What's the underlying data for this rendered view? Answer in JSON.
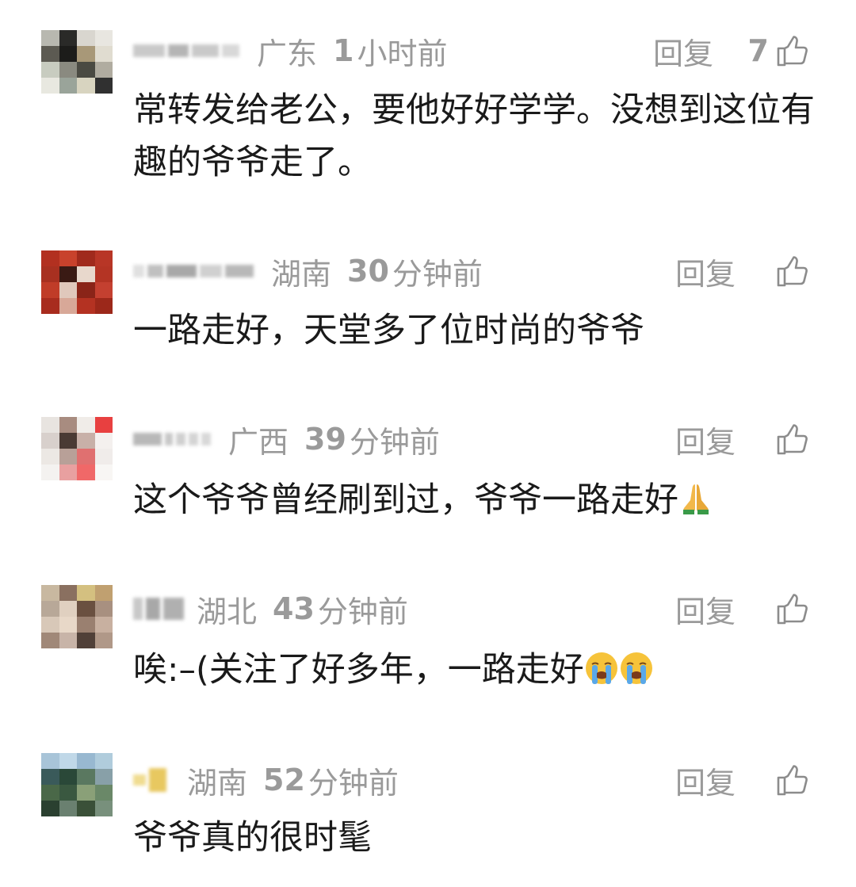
{
  "reply_label": "回复",
  "comments": [
    {
      "region": "广东",
      "time_num": "1",
      "time_unit": "小时前",
      "likes": "7",
      "text": "常转发给老公，要他好好学学。没想到这位有趣的爷爷走了。"
    },
    {
      "region": "湖南",
      "time_num": "30",
      "time_unit": "分钟前",
      "likes": "",
      "text": "一路走好，天堂多了位时尚的爷爷"
    },
    {
      "region": "广西",
      "time_num": "39",
      "time_unit": "分钟前",
      "likes": "",
      "text": "这个爷爷曾经刷到过，爷爷一路走好",
      "emoji": "folded-hands"
    },
    {
      "region": "湖北",
      "time_num": "43",
      "time_unit": "分钟前",
      "likes": "",
      "text": "唉:–(关注了好多年，一路走好",
      "emoji": "loudly-crying-face"
    },
    {
      "region": "湖南",
      "time_num": "52",
      "time_unit": "分钟前",
      "likes": "",
      "text": "爷爷真的很时髦"
    }
  ]
}
